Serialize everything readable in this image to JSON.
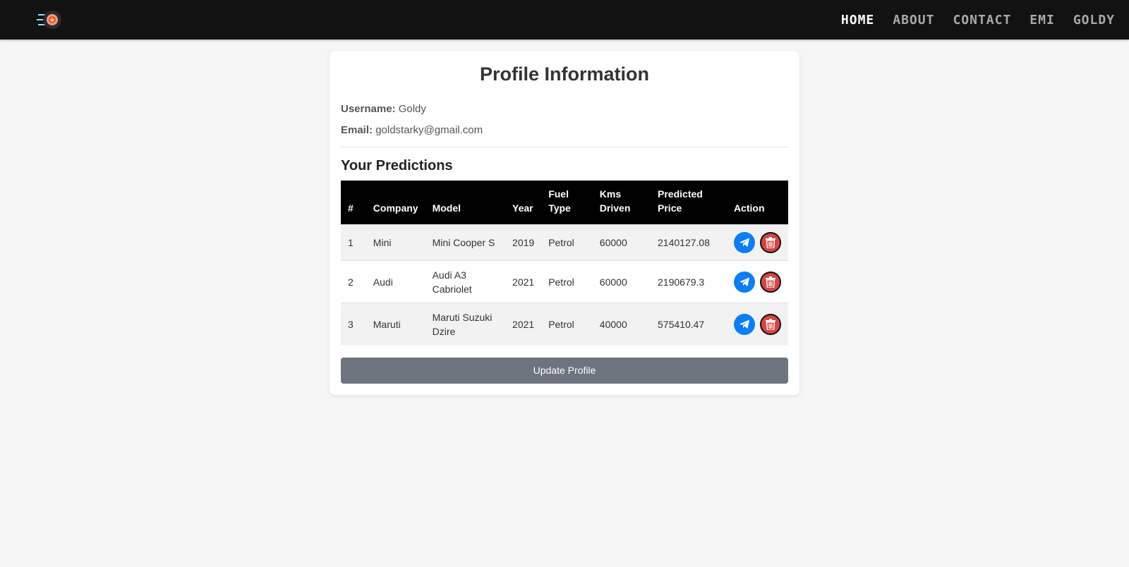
{
  "nav": {
    "links": [
      "HOME",
      "ABOUT",
      "CONTACT",
      "EMI",
      "GOLDY"
    ]
  },
  "profile": {
    "title": "Profile Information",
    "username_label": "Username:",
    "username": "Goldy",
    "email_label": "Email:",
    "email": "goldstarky@gmail.com"
  },
  "predictions": {
    "title": "Your Predictions",
    "headers": [
      "#",
      "Company",
      "Model",
      "Year",
      "Fuel Type",
      "Kms Driven",
      "Predicted Price",
      "Action"
    ],
    "rows": [
      {
        "num": "1",
        "company": "Mini",
        "model": "Mini Cooper S",
        "year": "2019",
        "fuel": "Petrol",
        "kms": "60000",
        "price": "2140127.08"
      },
      {
        "num": "2",
        "company": "Audi",
        "model": "Audi A3 Cabriolet",
        "year": "2021",
        "fuel": "Petrol",
        "kms": "60000",
        "price": "2190679.3"
      },
      {
        "num": "3",
        "company": "Maruti",
        "model": "Maruti Suzuki Dzire",
        "year": "2021",
        "fuel": "Petrol",
        "kms": "40000",
        "price": "575410.47"
      }
    ]
  },
  "update_button": "Update Profile",
  "colors": {
    "navbar": "#121212",
    "send_button": "#0d7df5",
    "delete_button": "#d64545",
    "update_button": "#6c757d"
  }
}
